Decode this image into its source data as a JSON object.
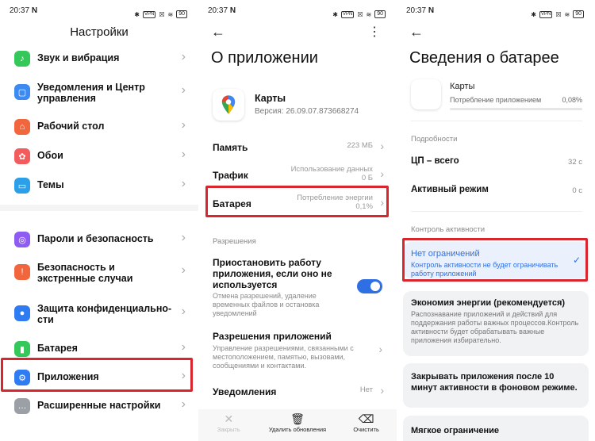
{
  "status": {
    "time": "20:37",
    "vpn": "VPN",
    "battery": "90"
  },
  "settings_screen": {
    "title": "Настройки",
    "items": [
      {
        "label": "Звук и вибрация",
        "icon": "speaker-icon",
        "color": "#34c759"
      },
      {
        "label": "Уведомления и Центр управления",
        "icon": "bell-icon",
        "color": "#3d8bf2"
      },
      {
        "label": "Рабочий стол",
        "icon": "home-icon",
        "color": "#f2663d"
      },
      {
        "label": "Обои",
        "icon": "flower-icon",
        "color": "#f25c5c"
      },
      {
        "label": "Темы",
        "icon": "theme-icon",
        "color": "#2ba0e8"
      },
      {
        "label": "Пароли и безопасность",
        "icon": "fingerprint-icon",
        "color": "#8e5cf2"
      },
      {
        "label": "Безопасность и экстренные случаи",
        "icon": "sos-icon",
        "color": "#f2663d"
      },
      {
        "label": "Защита конфиденциально-сти",
        "icon": "privacy-icon",
        "color": "#2f7cf2"
      },
      {
        "label": "Батарея",
        "icon": "battery-icon",
        "color": "#34c759"
      },
      {
        "label": "Приложения",
        "icon": "gear-icon",
        "color": "#2f7cf2"
      },
      {
        "label": "Расширенные настройки",
        "icon": "dots-icon",
        "color": "#9aa0a6"
      }
    ]
  },
  "app_screen": {
    "title": "О приложении",
    "app_name": "Карты",
    "version": "Версия: 26.09.07.873668274",
    "memory_label": "Память",
    "memory_value": "223 МБ",
    "traffic_label": "Трафик",
    "traffic_value": "Использование данных 0 Б",
    "battery_label": "Батарея",
    "battery_value": "Потребление энергии 0,1%",
    "permissions_header": "Разрешения",
    "pause_title": "Приостановить работу приложения, если оно не используется",
    "pause_desc": "Отмена разрешений, удаление временных файлов и остановка уведомлений",
    "app_perms_title": "Разрешения приложений",
    "app_perms_desc": "Управление разрешениями, связанными с местоположением, памятью, вызовами, сообщениями и контактами.",
    "notifications_label": "Уведомления",
    "notifications_value": "Нет",
    "bottom": {
      "close": "Закрыть",
      "uninstall": "Удалить обновления",
      "clear": "Очистить"
    }
  },
  "battery_screen": {
    "title": "Сведения о батарее",
    "app_name": "Карты",
    "usage_label": "Потребление приложением",
    "usage_value": "0,08%",
    "details_header": "Подробности",
    "cpu_label": "ЦП – всего",
    "cpu_value": "32 с",
    "active_label": "Активный режим",
    "active_value": "0 с",
    "control_header": "Контроль активности",
    "opt1_title": "Нет ограничений",
    "opt1_desc": "Контроль активности не будет ограничивать работу приложений",
    "opt2_title": "Экономия энергии (рекомендуется)",
    "opt2_desc": "Распознавание приложений и действий для поддержания работы важных процессов.Контроль активности будет обрабатывать важные приложения избирательно.",
    "opt3_title": "Закрывать приложения после 10 минут активности в фоновом режиме.",
    "opt4_title": "Мягкое ограничение"
  }
}
